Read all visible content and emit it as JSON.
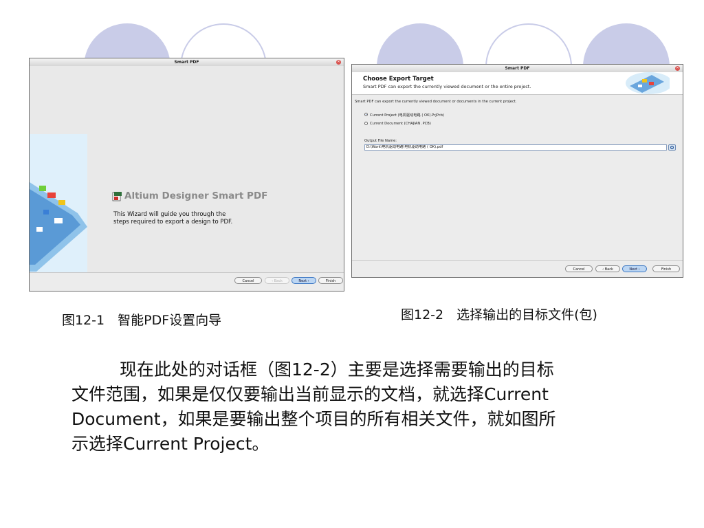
{
  "win1": {
    "title": "Smart PDF",
    "wizard_title": "Altium Designer Smart PDF",
    "wizard_line1": "This Wizard will guide you through the",
    "wizard_line2": "steps required to export a design to PDF.",
    "buttons": {
      "cancel": "Cancel",
      "back": "‹ Back",
      "next": "Next ›",
      "finish": "Finish"
    }
  },
  "win2": {
    "title": "Smart PDF",
    "header_title": "Choose Export Target",
    "header_sub": "Smart PDF can export the currently viewed document or the entire project.",
    "intro": "Smart PDF can export the currently viewed document or documents in the current project.",
    "option_project": "Current Project (电机驱动电路 ( OK).PrjPcb)",
    "option_document": "Current Document (CHAJIAN .PCB)",
    "output_label": "Output File Name:",
    "output_value": "D:\\Work\\电机驱动电路\\电机驱动电路 ( OK).pdf",
    "selected_option": "Current Project",
    "buttons": {
      "cancel": "Cancel",
      "back": "‹ Back",
      "next": "Next ›",
      "finish": "Finish"
    }
  },
  "captions": {
    "fig1": "图12-1　智能PDF设置向导",
    "fig2": "图12-2　选择输出的目标文件(包)"
  },
  "body": {
    "line1": "现在此处的对话框（图12-2）主要是选择需要输出的目标",
    "line2": "文件范围，如果是仅仅要输出当前显示的文档，就选择Current",
    "line3": "Document，如果是要输出整个项目的所有相关文件，就如图所",
    "line4": "示选择Current  Project。"
  },
  "colors": {
    "deco": "#c9cce8",
    "next_button": "#bcd6f3",
    "wizard_title": "#8a8a8a"
  }
}
